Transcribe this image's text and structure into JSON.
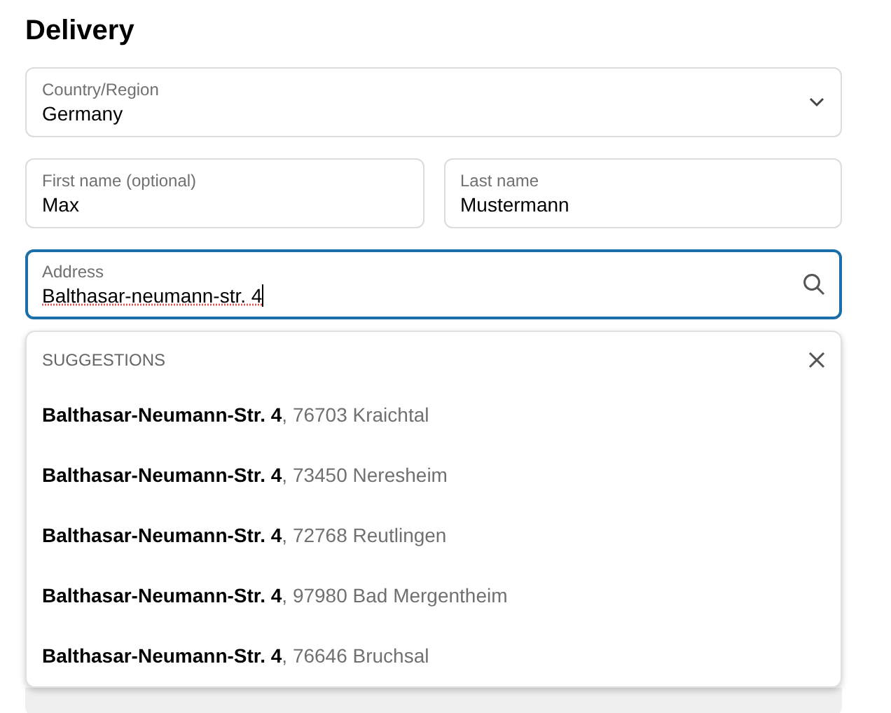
{
  "heading": "Delivery",
  "fields": [
    {
      "kind": "select",
      "label": "Country/Region",
      "value": "Germany",
      "focused": false
    },
    {
      "kind": "text",
      "label": "First name (optional)",
      "value": "Max",
      "focused": false
    },
    {
      "kind": "text",
      "label": "Last name",
      "value": "Mustermann",
      "focused": false
    },
    {
      "kind": "search",
      "label": "Address",
      "value": "Balthasar-neumann-str. 4",
      "focused": true
    }
  ],
  "suggestions": {
    "title": "SUGGESTIONS",
    "items": [
      "**Balthasar-Neumann-Str. 4**, 76703 Kraichtal",
      "**Balthasar-Neumann-Str. 4**, 73450 Neresheim",
      "**Balthasar-Neumann-Str. 4**, 72768 Reutlingen",
      "**Balthasar-Neumann-Str. 4**, 97980 Bad Mergentheim",
      "**Balthasar-Neumann-Str. 4**, 76646 Bruchsal"
    ]
  }
}
